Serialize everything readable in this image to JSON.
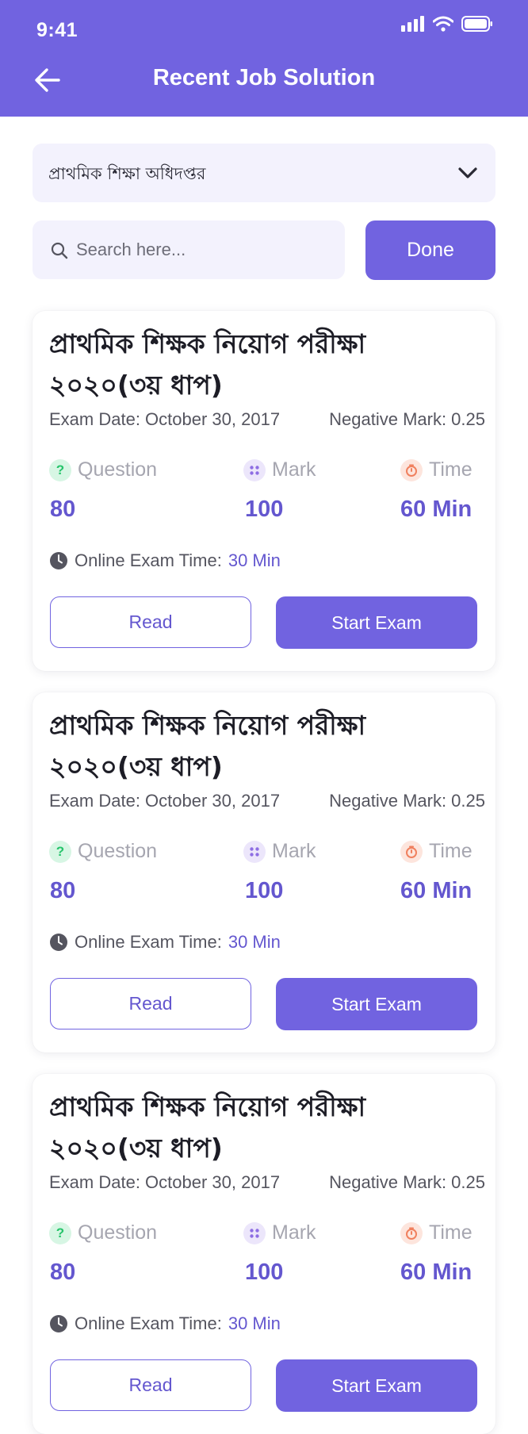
{
  "status_bar": {
    "time": "9:41"
  },
  "header": {
    "title": "Recent Job Solution"
  },
  "filter": {
    "selected": "প্রাথমিক শিক্ষা অধিদপ্তর"
  },
  "search": {
    "placeholder": "Search here...",
    "done_label": "Done"
  },
  "cards": [
    {
      "title": "প্রাথমিক শিক্ষক নিয়োগ পরীক্ষা ২০২০(৩য় ধাপ)",
      "exam_date": "Exam Date: October 30, 2017",
      "negative_mark": "Negative Mark: 0.25",
      "question_label": "Question",
      "question_value": "80",
      "mark_label": "Mark",
      "mark_value": "100",
      "time_label": "Time",
      "time_value": "60 Min",
      "online_label": "Online Exam Time:",
      "online_value": "30 Min",
      "read_label": "Read",
      "start_label": "Start Exam"
    },
    {
      "title": "প্রাথমিক শিক্ষক নিয়োগ পরীক্ষা ২০২০(৩য় ধাপ)",
      "exam_date": "Exam Date: October 30, 2017",
      "negative_mark": "Negative Mark: 0.25",
      "question_label": "Question",
      "question_value": "80",
      "mark_label": "Mark",
      "mark_value": "100",
      "time_label": "Time",
      "time_value": "60 Min",
      "online_label": "Online Exam Time:",
      "online_value": "30 Min",
      "read_label": "Read",
      "start_label": "Start Exam"
    },
    {
      "title": "প্রাথমিক শিক্ষক নিয়োগ পরীক্ষা ২০২০(৩য় ধাপ)",
      "exam_date": "Exam Date: October 30, 2017",
      "negative_mark": "Negative Mark: 0.25",
      "question_label": "Question",
      "question_value": "80",
      "mark_label": "Mark",
      "mark_value": "100",
      "time_label": "Time",
      "time_value": "60 Min",
      "online_label": "Online Exam Time:",
      "online_value": "30 Min",
      "read_label": "Read",
      "start_label": "Start Exam"
    }
  ],
  "icons": {
    "back": "arrow-left-icon",
    "dropdown": "chevron-down-icon",
    "search": "search-icon",
    "question": "question-icon",
    "mark": "grid-icon",
    "time": "timer-icon",
    "online": "clock-icon"
  },
  "colors": {
    "primary": "#7163e0",
    "value_text": "#6457cf",
    "field_bg": "#f3f2fd"
  }
}
